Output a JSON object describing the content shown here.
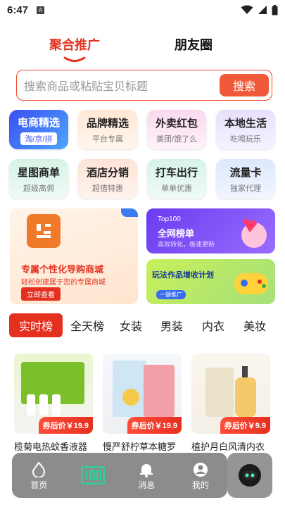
{
  "status": {
    "time": "6:47"
  },
  "top_tabs": {
    "active": "聚合推广",
    "inactive": "朋友圈"
  },
  "search": {
    "placeholder": "搜索商品或粘贴宝贝标题",
    "button": "搜索"
  },
  "categories": [
    {
      "title": "电商精选",
      "sub": "淘/京/拼"
    },
    {
      "title": "品牌精选",
      "sub": "平台专属"
    },
    {
      "title": "外卖红包",
      "sub": "美团/饿了么"
    },
    {
      "title": "本地生活",
      "sub": "吃喝玩乐"
    },
    {
      "title": "星图商单",
      "sub": "超级高佣"
    },
    {
      "title": "酒店分销",
      "sub": "超值特惠"
    },
    {
      "title": "打车出行",
      "sub": "单单优惠"
    },
    {
      "title": "流量卡",
      "sub": "独家代理"
    }
  ],
  "banners": {
    "left": {
      "title": "专属个性化导购商城",
      "sub": "轻松创建属于您的专属商城",
      "button": "立即查看"
    },
    "right_top": {
      "k1": "Top100",
      "k2": "全网榜单",
      "k3": "高效转化，极速更新"
    },
    "right_bottom": {
      "k1": "玩法作品增收计划",
      "k2": "一键推广"
    }
  },
  "filter_tabs": [
    "实时榜",
    "全天榜",
    "女装",
    "男装",
    "内衣",
    "美妆"
  ],
  "products": [
    {
      "name": "榄菊电热蚊香液器",
      "badge": "券后价￥19.9"
    },
    {
      "name": "慢严舒柠草本糖罗",
      "badge": "券后价￥19.9"
    },
    {
      "name": "植护月白风清内衣",
      "badge": "券后价￥9.9"
    }
  ],
  "bottom_nav": {
    "home": "首页",
    "message": "消息",
    "mine": "我的"
  },
  "colors": {
    "accent": "#e5301f",
    "search_btn": "#f05a3a"
  }
}
